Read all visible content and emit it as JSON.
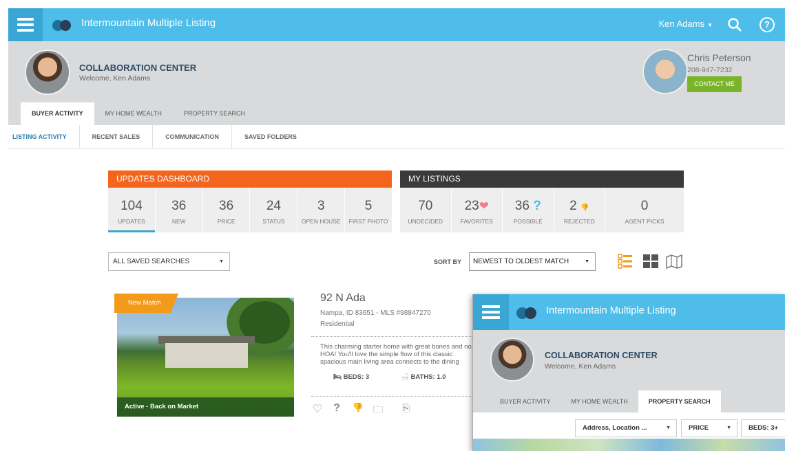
{
  "app": {
    "brand": "Intermountain Multiple Listing",
    "user": "Ken Adams"
  },
  "header": {
    "title": "COLLABORATION CENTER",
    "welcome": "Welcome, Ken Adams",
    "agent": {
      "name": "Chris Peterson",
      "phone": "208-947-7232",
      "contact_label": "CONTACT ME"
    },
    "tabs": [
      {
        "label": "BUYER ACTIVITY",
        "active": true
      },
      {
        "label": "MY HOME WEALTH",
        "active": false
      },
      {
        "label": "PROPERTY SEARCH",
        "active": false
      }
    ]
  },
  "subtabs": [
    "LISTING ACTIVITY",
    "RECENT SALES",
    "COMMUNICATION",
    "SAVED FOLDERS"
  ],
  "updates": {
    "title": "UPDATES DASHBOARD",
    "cells": [
      {
        "num": "104",
        "label": "UPDATES"
      },
      {
        "num": "36",
        "label": "NEW"
      },
      {
        "num": "36",
        "label": "PRICE"
      },
      {
        "num": "24",
        "label": "STATUS"
      },
      {
        "num": "3",
        "label": "OPEN HOUSE"
      },
      {
        "num": "5",
        "label": "FIRST PHOTO"
      }
    ]
  },
  "mylistings": {
    "title": "MY LISTINGS",
    "cells": [
      {
        "num": "70",
        "label": "UNDECIDED"
      },
      {
        "num": "23",
        "label": "FAVORITES",
        "icon": "heart-icon"
      },
      {
        "num": "36",
        "label": "POSSIBLE",
        "icon": "question-icon"
      },
      {
        "num": "2",
        "label": "REJECTED",
        "icon": "thumbs-down-icon"
      },
      {
        "num": "0",
        "label": "AGENT PICKS"
      }
    ]
  },
  "controls": {
    "saved_searches": "ALL SAVED SEARCHES",
    "sort_label": "SORT BY",
    "sort_value": "NEWEST TO OLDEST MATCH"
  },
  "listing": {
    "badge": "New Match",
    "status": "Active - Back on Market",
    "address": "92 N Ada",
    "city_line": "Nampa, ID 83651 - MLS #98847270",
    "type": "Residential",
    "description": "This charming starter home with great bones and no HOA! You'll love the simple flow of this classic spacious main living area connects to the dining",
    "beds": "BEDS: 3",
    "baths": "BATHS: 1.0"
  },
  "overlay": {
    "brand": "Intermountain Multiple Listing",
    "title": "COLLABORATION CENTER",
    "welcome": "Welcome, Ken Adams",
    "tabs": [
      {
        "label": "BUYER ACTIVITY",
        "active": false
      },
      {
        "label": "MY HOME WEALTH",
        "active": false
      },
      {
        "label": "PROPERTY SEARCH",
        "active": true
      }
    ],
    "filters": {
      "location": "Address, Location ...",
      "price": "PRICE",
      "beds": "BEDS: 3+"
    }
  },
  "colors": {
    "topbar": "#4fbde9",
    "updates": "#f5641c",
    "mylistings": "#3a3a3a",
    "contact": "#7bb42a",
    "badge": "#f39a1a"
  }
}
